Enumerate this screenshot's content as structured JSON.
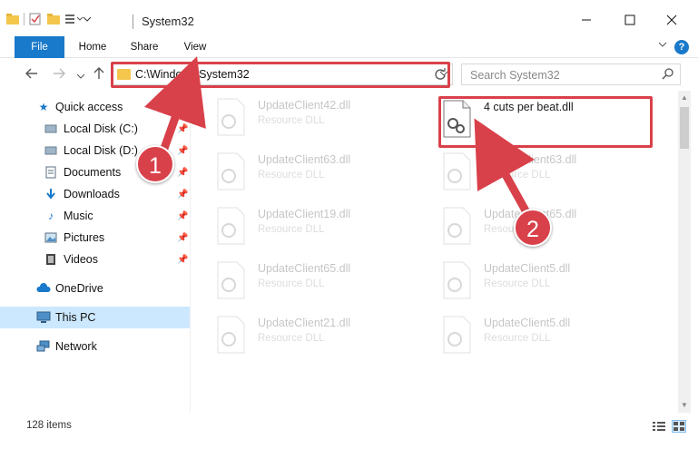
{
  "window": {
    "title": "System32",
    "min_icon": "minimize-icon",
    "max_icon": "maximize-icon",
    "close_icon": "close-icon"
  },
  "ribbon": {
    "tabs": [
      {
        "label": "File"
      },
      {
        "label": "Home"
      },
      {
        "label": "Share"
      },
      {
        "label": "View"
      }
    ],
    "help": "?"
  },
  "nav": {
    "back_icon": "back-arrow-icon",
    "forward_icon": "forward-arrow-icon",
    "up_icon": "up-arrow-icon",
    "address": "C:\\Windows\\System32",
    "search_placeholder": "Search System32"
  },
  "sidebar": {
    "items": [
      {
        "label": "Quick access",
        "icon": "star-icon",
        "pinned": false
      },
      {
        "label": "Local Disk (C:)",
        "icon": "drive-icon",
        "pinned": true
      },
      {
        "label": "Local Disk (D:)",
        "icon": "drive-icon",
        "pinned": true
      },
      {
        "label": "Documents",
        "icon": "documents-icon",
        "pinned": true
      },
      {
        "label": "Downloads",
        "icon": "download-icon",
        "pinned": true
      },
      {
        "label": "Music",
        "icon": "music-icon",
        "pinned": true
      },
      {
        "label": "Pictures",
        "icon": "pictures-icon",
        "pinned": true
      },
      {
        "label": "Videos",
        "icon": "videos-icon",
        "pinned": true
      },
      {
        "label": "OneDrive",
        "icon": "cloud-icon",
        "pinned": false
      },
      {
        "label": "This PC",
        "icon": "computer-icon",
        "pinned": false,
        "selected": true
      },
      {
        "label": "Network",
        "icon": "network-icon",
        "pinned": false
      }
    ]
  },
  "files": {
    "left": [
      {
        "name": "UpdateClient42.dll",
        "type": "Resource DLL"
      },
      {
        "name": "UpdateClient63.dll",
        "type": "Resource DLL"
      },
      {
        "name": "UpdateClient19.dll",
        "type": "Resource DLL"
      },
      {
        "name": "UpdateClient65.dll",
        "type": "Resource DLL"
      },
      {
        "name": "UpdateClient21.dll",
        "type": "Resource DLL"
      }
    ],
    "right": [
      {
        "name": "4 cuts per beat.dll",
        "type": ""
      },
      {
        "name": "UpdateClient63.dll",
        "type": "Resource DLL"
      },
      {
        "name": "UpdateClient65.dll",
        "type": "Resource DLL"
      },
      {
        "name": "UpdateClient5.dll",
        "type": "Resource DLL"
      },
      {
        "name": "UpdateClient5.dll",
        "type": "Resource DLL"
      }
    ]
  },
  "status": {
    "item_count": "128 items"
  },
  "callouts": {
    "one": "1",
    "two": "2"
  },
  "colors": {
    "accent": "#1979ca",
    "highlight": "#d9414a",
    "selection": "#cce8ff"
  }
}
